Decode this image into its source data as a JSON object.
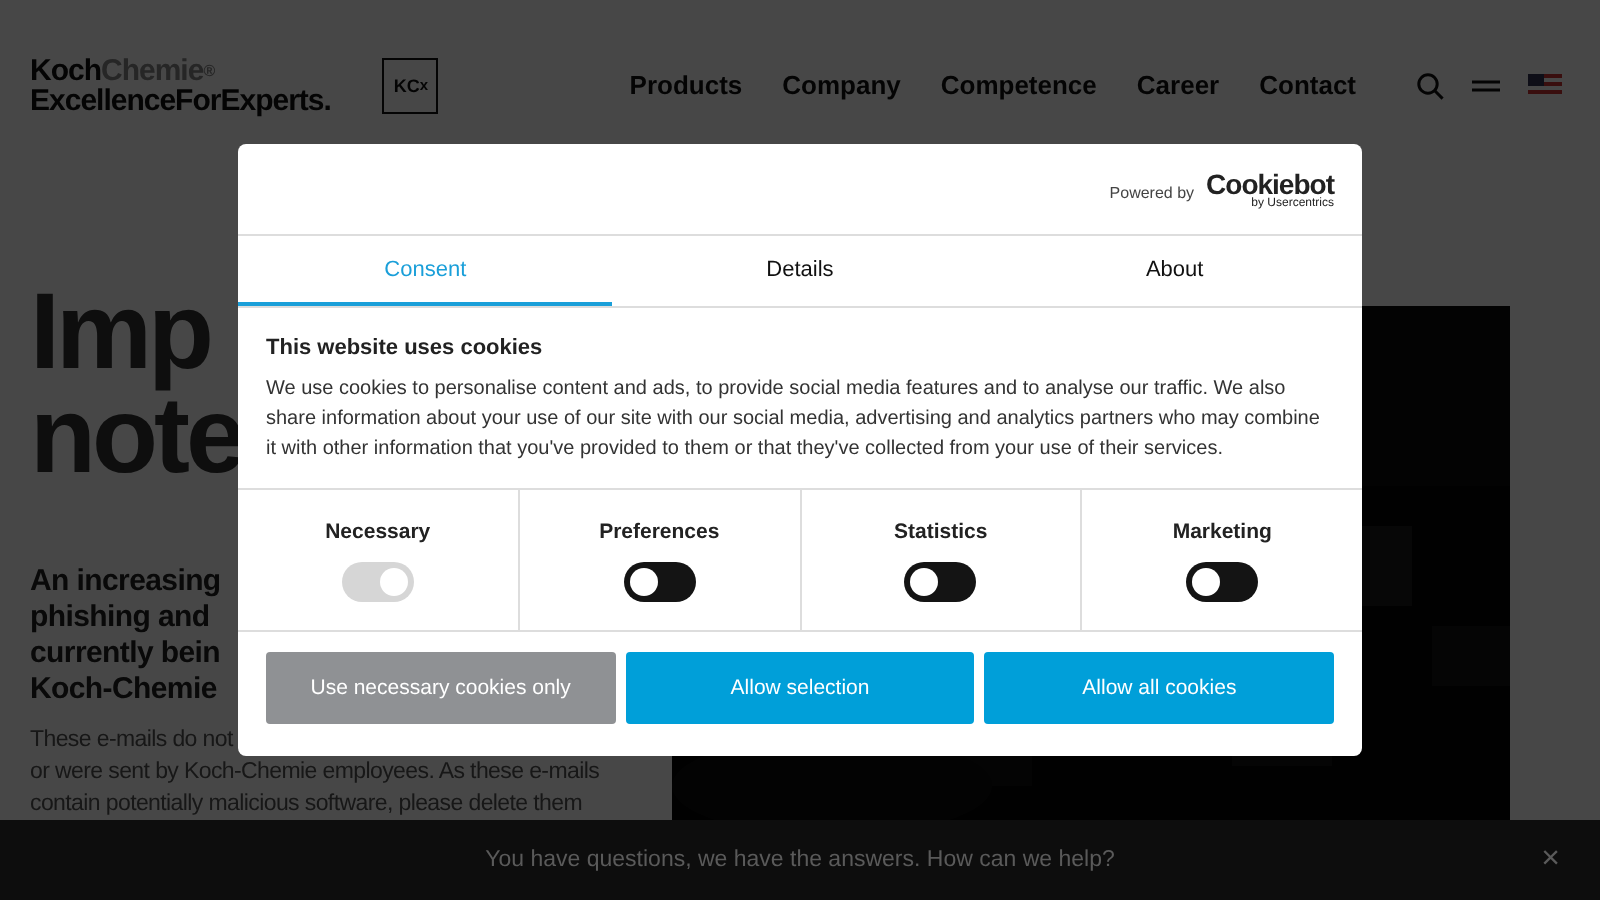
{
  "header": {
    "logo": {
      "brand_dark": "Koch",
      "brand_light": "Chemie",
      "mark": "®",
      "tagline": "ExcellenceForExperts."
    },
    "badge": {
      "text": "KC",
      "sub": "x"
    },
    "nav": [
      "Products",
      "Company",
      "Competence",
      "Career",
      "Contact"
    ]
  },
  "hero": {
    "heading": [
      "Imp",
      "note"
    ],
    "subheading": [
      "An increasing",
      "phishing and",
      "currently bein",
      "Koch-Chemie"
    ],
    "paragraph": [
      "These e-mails do not",
      "or were sent by Koch-Chemie employees. As these e-mails",
      "contain potentially malicious software, please delete them"
    ],
    "media": {
      "kind": "picture"
    }
  },
  "chat_bar": {
    "text": "You have questions, we have the answers. How can we help?",
    "close": "×"
  },
  "cookie_dialog": {
    "powered_by": "Powered by",
    "brand": "Cookiebot",
    "brand_sub": "by Usercentrics",
    "tabs": [
      {
        "label": "Consent",
        "selected": true
      },
      {
        "label": "Details",
        "selected": false
      },
      {
        "label": "About",
        "selected": false
      }
    ],
    "title": "This website uses cookies",
    "body": "We use cookies to personalise content and ads, to provide social media features and to analyse our traffic. We also share information about your use of our site with our social media, advertising and analytics partners who may combine it with other information that you've provided to them or that they've collected from your use of their services.",
    "categories": [
      {
        "label": "Necessary",
        "checked": true,
        "disabled": true
      },
      {
        "label": "Preferences",
        "checked": false,
        "disabled": false
      },
      {
        "label": "Statistics",
        "checked": false,
        "disabled": false
      },
      {
        "label": "Marketing",
        "checked": false,
        "disabled": false
      }
    ],
    "buttons": [
      {
        "label": "Use necessary cookies only",
        "kind": "secondary"
      },
      {
        "label": "Allow selection",
        "kind": "primary"
      },
      {
        "label": "Allow all cookies",
        "kind": "primary"
      }
    ]
  }
}
